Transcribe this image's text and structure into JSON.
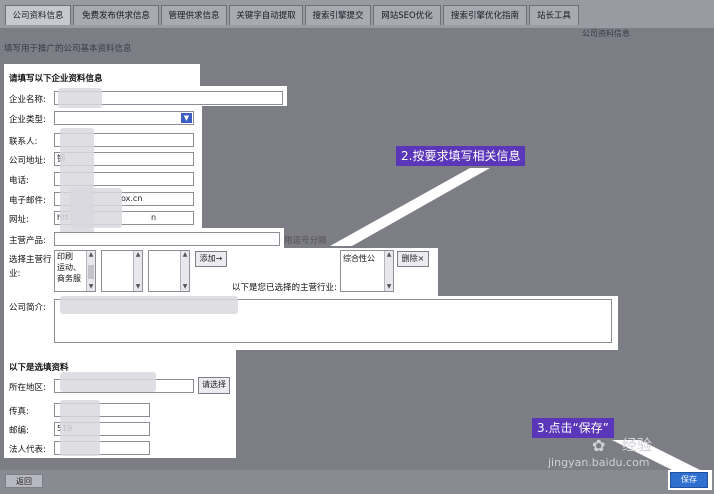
{
  "tabs": [
    {
      "label": "公司资料信息"
    },
    {
      "label": "免费发布供求信息"
    },
    {
      "label": "管理供求信息"
    },
    {
      "label": "关键字自动提取"
    },
    {
      "label": "搜索引擎提交"
    },
    {
      "label": "网站SEO优化"
    },
    {
      "label": "搜索引擎优化指南"
    },
    {
      "label": "站长工具"
    }
  ],
  "header": {
    "right_label": "公司资料信息",
    "subtitle": "填写用于推广的公司基本资料信息"
  },
  "form": {
    "section_required": "请填写以下企业资料信息",
    "company_name_label": "企业名称:",
    "company_type_label": "企业类型:",
    "contact_label": "联系人:",
    "contact_value": "",
    "address_label": "公司地址:",
    "address_value": "钢",
    "phone_label": "电话:",
    "phone_value": "",
    "email_label": "电子邮件:",
    "email_value": "ox.cn",
    "website_label": "网址:",
    "website_value_prefix": "htt",
    "website_value_suffix": "n",
    "products_label": "主营产品:",
    "products_hint": "用逗号分隔",
    "industry_label_line1": "选择主营行",
    "industry_label_line2": "业:",
    "industry_options": [
      "印刷",
      "运动、",
      "商务服",
      "...."
    ],
    "add_button": "添加→",
    "selected_note": "以下是您已选择的主营行业:",
    "selected_industry": "综合性公",
    "delete_button": "删除×",
    "intro_label": "公司简介:",
    "section_optional": "以下是选填资料",
    "region_label": "所在地区:",
    "region_button": "请选择",
    "fax_label": "传真:",
    "fax_value": "",
    "postcode_label": "邮编:",
    "postcode_value": "519",
    "legal_label": "法人代表:"
  },
  "callouts": {
    "step2": "2.按要求填写相关信息",
    "step3": "3.点击“保存”"
  },
  "footer": {
    "back_button": "返回",
    "save_button": "保存"
  },
  "watermark": {
    "brand": "经验",
    "url": "jingyan.baidu.com"
  },
  "colors": {
    "overlay": "#7d7d86",
    "callout": "#5a36b8",
    "save": "#2f6fd0"
  }
}
